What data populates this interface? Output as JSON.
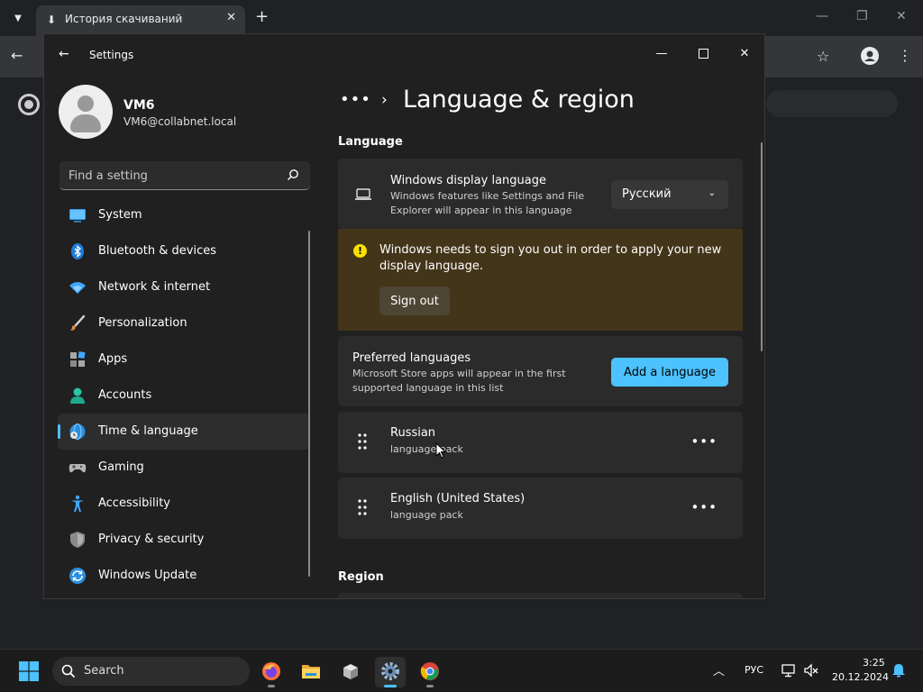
{
  "browser": {
    "tab_title": "История скачиваний"
  },
  "settings": {
    "window_title": "Settings",
    "profile": {
      "name": "VM6",
      "email": "VM6@collabnet.local"
    },
    "search": {
      "placeholder": "Find a setting"
    },
    "nav": {
      "items": [
        {
          "label": "System",
          "icon": "monitor-icon"
        },
        {
          "label": "Bluetooth & devices",
          "icon": "bluetooth-icon"
        },
        {
          "label": "Network & internet",
          "icon": "wifi-icon"
        },
        {
          "label": "Personalization",
          "icon": "brush-icon"
        },
        {
          "label": "Apps",
          "icon": "apps-icon"
        },
        {
          "label": "Accounts",
          "icon": "person-icon"
        },
        {
          "label": "Time & language",
          "icon": "globe-clock-icon"
        },
        {
          "label": "Gaming",
          "icon": "gamepad-icon"
        },
        {
          "label": "Accessibility",
          "icon": "accessibility-icon"
        },
        {
          "label": "Privacy & security",
          "icon": "shield-icon"
        },
        {
          "label": "Windows Update",
          "icon": "update-icon"
        }
      ],
      "active": "Time & language"
    },
    "breadcrumb_more": "•••",
    "page_title": "Language & region",
    "language": {
      "section_label": "Language",
      "display_language": {
        "title": "Windows display language",
        "description": "Windows features like Settings and File Explorer will appear in this language",
        "selected": "Русский"
      },
      "warning": {
        "text": "Windows needs to sign you out in order to apply your new display language.",
        "button": "Sign out"
      },
      "preferred": {
        "title": "Preferred languages",
        "description": "Microsoft Store apps will appear in the first supported language in this list",
        "button": "Add a language"
      },
      "languages": [
        {
          "name": "Russian",
          "detail": "language pack"
        },
        {
          "name": "English (United States)",
          "detail": "language pack"
        }
      ]
    },
    "region": {
      "section_label": "Region"
    }
  },
  "taskbar": {
    "search_label": "Search",
    "tray": {
      "language": "РУС",
      "time": "3:25",
      "date": "20.12.2024"
    }
  },
  "colors": {
    "accent": "#4cc2ff",
    "warning_bg": "#433519",
    "warning_icon": "#fce100"
  }
}
